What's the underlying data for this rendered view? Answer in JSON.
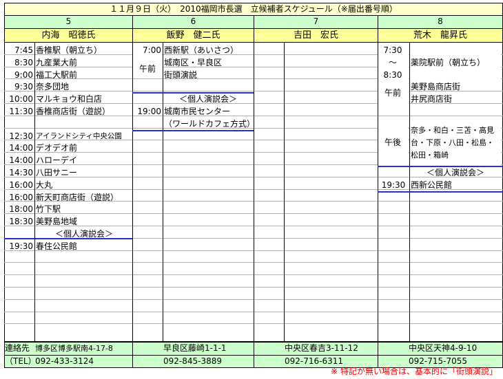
{
  "title": "１１月９日（火）　2010福岡市長選　立候補者スケジュール（※届出番号順）",
  "columns": [
    {
      "number": "5",
      "name": "内海　昭徳氏"
    },
    {
      "number": "6",
      "name": "飯野　健二氏"
    },
    {
      "number": "7",
      "name": "吉田　宏氏"
    },
    {
      "number": "8",
      "name": "荒木　龍昇氏"
    }
  ],
  "col5_events": [
    {
      "time": "7:45",
      "text": "香椎駅（朝立ち）"
    },
    {
      "time": "8:30",
      "text": "九産業大前"
    },
    {
      "time": "9:00",
      "text": "福工大駅前"
    },
    {
      "time": "9:30",
      "text": "奈多団地"
    },
    {
      "time": "10:00",
      "text": "マルキョウ和白店"
    },
    {
      "time": "11:30",
      "text": "香椎商店街（遊説）"
    },
    {
      "time": "",
      "text": ""
    },
    {
      "time": "12:30",
      "text": "アイランドシティ中央公園"
    },
    {
      "time": "14:00",
      "text": "デオデオ前"
    },
    {
      "time": "14:00",
      "text": "ハローデイ"
    },
    {
      "time": "14:30",
      "text": "八田サニー"
    },
    {
      "time": "16:00",
      "text": "大丸"
    },
    {
      "time": "16:00",
      "text": "新天町商店街（遊説）"
    },
    {
      "time": "18:00",
      "text": "竹下駅"
    },
    {
      "time": "18:30",
      "text": "美野島地域"
    },
    {
      "time": "",
      "text": "＜個人演説会＞"
    },
    {
      "time": "19:30",
      "text": "春住公民館"
    }
  ],
  "col6": {
    "time1": "7:00",
    "event1": "西新駅（あいさつ）",
    "period": "午前",
    "event2": "城南区・早良区",
    "event3": "街頭演説",
    "meeting": "＜個人演説会＞",
    "time2": "19:00",
    "event4": "城南市民センター",
    "event5": "（ワールドカフェ方式）"
  },
  "col8": {
    "time_start": "7:30",
    "tilde": "～",
    "time_end": "8:30",
    "event1": "薬院駅前（朝立ち）",
    "am": "午前",
    "am_event1": "美野島商店街",
    "am_event2": "井尻商店街",
    "pm": "午後",
    "pm_line1": "奈多・和白・三苫・高見",
    "pm_line2": "台・下原・八田・松島・",
    "pm_line3": "松田・箱崎",
    "meeting": "＜個人演説会＞",
    "time2": "19:30",
    "event2": "西新公民館"
  },
  "footer": {
    "contact_label": "連絡先",
    "tel_label": "（TEL）",
    "addresses": [
      "博多区博多駅南4-17-8",
      "早良区藤崎1-1-1",
      "中央区春吉3-11-12",
      "中央区天神4-9-10"
    ],
    "phones": [
      "092-433-3124",
      "092-845-3889",
      "092-716-6311",
      "092-715-7055"
    ]
  },
  "note": "※ 特記が無い場合は、基本的に「街頭演説」",
  "colors": {
    "title_bg": "#ffffcc",
    "header_bg": "#ccffcc",
    "name_bg": "#ffff99",
    "footer_bg": "#ccffcc",
    "accent_line": "#2233cc",
    "note": "#ff0000"
  }
}
